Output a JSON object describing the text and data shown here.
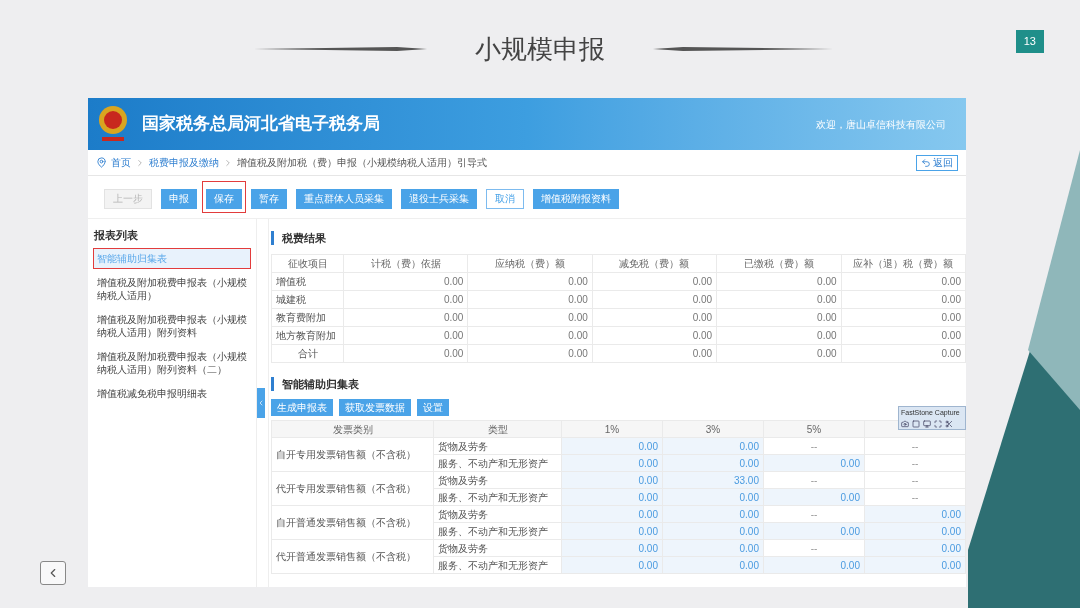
{
  "slide": {
    "title": "小规模申报",
    "page_number": "13"
  },
  "site": {
    "title": "国家税务总局河北省电子税务局",
    "welcome": "欢迎，唐山卓信科技有限公司"
  },
  "breadcrumb": [
    {
      "label": "首页",
      "link": true
    },
    {
      "label": "税费申报及缴纳",
      "link": true
    },
    {
      "label": "增值税及附加税（费）申报（小规模纳税人适用）引导式",
      "link": false
    }
  ],
  "back_button": "返回",
  "toolbar": [
    {
      "label": "上一步",
      "kind": "disabled",
      "highlighted": false
    },
    {
      "label": "申报",
      "kind": "primary",
      "highlighted": false
    },
    {
      "label": "保存",
      "kind": "primary",
      "highlighted": true
    },
    {
      "label": "暂存",
      "kind": "primary",
      "highlighted": false
    },
    {
      "label": "重点群体人员采集",
      "kind": "primary",
      "highlighted": false
    },
    {
      "label": "退役士兵采集",
      "kind": "primary",
      "highlighted": false
    },
    {
      "label": "取消",
      "kind": "outline",
      "highlighted": false
    },
    {
      "label": "增值税附报资料",
      "kind": "primary",
      "highlighted": false
    }
  ],
  "sidebar": {
    "title": "报表列表",
    "items": [
      {
        "label": "智能辅助归集表",
        "selected": true,
        "highlighted": true
      },
      {
        "label": "增值税及附加税费申报表（小规模纳税人适用）",
        "selected": false,
        "highlighted": false
      },
      {
        "label": "增值税及附加税费申报表（小规模纳税人适用）附列资料",
        "selected": false,
        "highlighted": false
      },
      {
        "label": "增值税及附加税费申报表（小规模纳税人适用）附列资料（二）",
        "selected": false,
        "highlighted": false
      },
      {
        "label": "增值税减免税申报明细表",
        "selected": false,
        "highlighted": false
      }
    ]
  },
  "tax_result": {
    "title": "税费结果",
    "columns": [
      "征收项目",
      "计税（费）依据",
      "应纳税（费）额",
      "减免税（费）额",
      "已缴税（费）额",
      "应补（退）税（费）额"
    ],
    "rows": [
      {
        "item": "增值税",
        "total": false,
        "values": [
          "0.00",
          "0.00",
          "0.00",
          "0.00",
          "0.00"
        ]
      },
      {
        "item": "城建税",
        "total": false,
        "values": [
          "0.00",
          "0.00",
          "0.00",
          "0.00",
          "0.00"
        ]
      },
      {
        "item": "教育费附加",
        "total": false,
        "values": [
          "0.00",
          "0.00",
          "0.00",
          "0.00",
          "0.00"
        ]
      },
      {
        "item": "地方教育附加",
        "total": false,
        "values": [
          "0.00",
          "0.00",
          "0.00",
          "0.00",
          "0.00"
        ]
      },
      {
        "item": "合计",
        "total": true,
        "values": [
          "0.00",
          "0.00",
          "0.00",
          "0.00",
          "0.00"
        ]
      }
    ]
  },
  "collection": {
    "title": "智能辅助归集表",
    "buttons": [
      "生成申报表",
      "获取发票数据",
      "设置"
    ],
    "columns": [
      "发票类别",
      "类型",
      "1%",
      "3%",
      "5%"
    ],
    "groups": [
      {
        "category": "自开专用发票销售额（不含税）",
        "rows": [
          {
            "type": "货物及劳务",
            "cells": [
              {
                "text": "0.00",
                "kind": "input"
              },
              {
                "text": "0.00",
                "kind": "input"
              },
              {
                "text": "--",
                "kind": "fixed"
              },
              {
                "text": "--",
                "kind": "fixed"
              }
            ]
          },
          {
            "type": "服务、不动产和无形资产",
            "cells": [
              {
                "text": "0.00",
                "kind": "input"
              },
              {
                "text": "0.00",
                "kind": "input"
              },
              {
                "text": "0.00",
                "kind": "input"
              },
              {
                "text": "--",
                "kind": "fixed"
              }
            ]
          }
        ]
      },
      {
        "category": "代开专用发票销售额（不含税）",
        "rows": [
          {
            "type": "货物及劳务",
            "cells": [
              {
                "text": "0.00",
                "kind": "input"
              },
              {
                "text": "33.00",
                "kind": "input"
              },
              {
                "text": "--",
                "kind": "fixed"
              },
              {
                "text": "--",
                "kind": "fixed"
              }
            ]
          },
          {
            "type": "服务、不动产和无形资产",
            "cells": [
              {
                "text": "0.00",
                "kind": "input"
              },
              {
                "text": "0.00",
                "kind": "input"
              },
              {
                "text": "0.00",
                "kind": "input"
              },
              {
                "text": "--",
                "kind": "fixed"
              }
            ]
          }
        ]
      },
      {
        "category": "自开普通发票销售额（不含税）",
        "rows": [
          {
            "type": "货物及劳务",
            "cells": [
              {
                "text": "0.00",
                "kind": "input"
              },
              {
                "text": "0.00",
                "kind": "input"
              },
              {
                "text": "--",
                "kind": "fixed"
              },
              {
                "text": "0.00",
                "kind": "input"
              }
            ]
          },
          {
            "type": "服务、不动产和无形资产",
            "cells": [
              {
                "text": "0.00",
                "kind": "input"
              },
              {
                "text": "0.00",
                "kind": "input"
              },
              {
                "text": "0.00",
                "kind": "input"
              },
              {
                "text": "0.00",
                "kind": "input"
              }
            ]
          }
        ]
      },
      {
        "category": "代开普通发票销售额（不含税）",
        "rows": [
          {
            "type": "货物及劳务",
            "cells": [
              {
                "text": "0.00",
                "kind": "input"
              },
              {
                "text": "0.00",
                "kind": "input"
              },
              {
                "text": "--",
                "kind": "fixed"
              },
              {
                "text": "0.00",
                "kind": "input"
              }
            ]
          },
          {
            "type": "服务、不动产和无形资产",
            "cells": [
              {
                "text": "0.00",
                "kind": "input"
              },
              {
                "text": "0.00",
                "kind": "input"
              },
              {
                "text": "0.00",
                "kind": "input"
              },
              {
                "text": "0.00",
                "kind": "input"
              }
            ]
          }
        ]
      }
    ]
  },
  "capture_toolbar": {
    "title": "FastStone Capture"
  }
}
